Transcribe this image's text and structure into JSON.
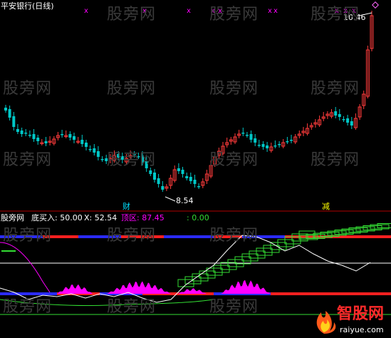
{
  "title": "平安银行(日线)",
  "price_high_label": "10.46",
  "price_low_label": "8.54",
  "marker_cai": "财",
  "marker_jian": "减",
  "indicator": {
    "name": "股旁网",
    "buy_label": "底买入: 50.00",
    "x_label": "X: 52.54",
    "top_label": "顶区: 87.45",
    "extra_label": ": 0.00"
  },
  "watermark": "股旁网",
  "logo": {
    "name": "智股网",
    "url": "raiyue.com"
  },
  "colors": {
    "up": "#ff3b3b",
    "down": "#00c8c8",
    "magenta": "#ff00ff",
    "green": "#33dd33",
    "white": "#ffffff",
    "blue": "#2b2bff",
    "red_bar": "#ff2020"
  }
}
